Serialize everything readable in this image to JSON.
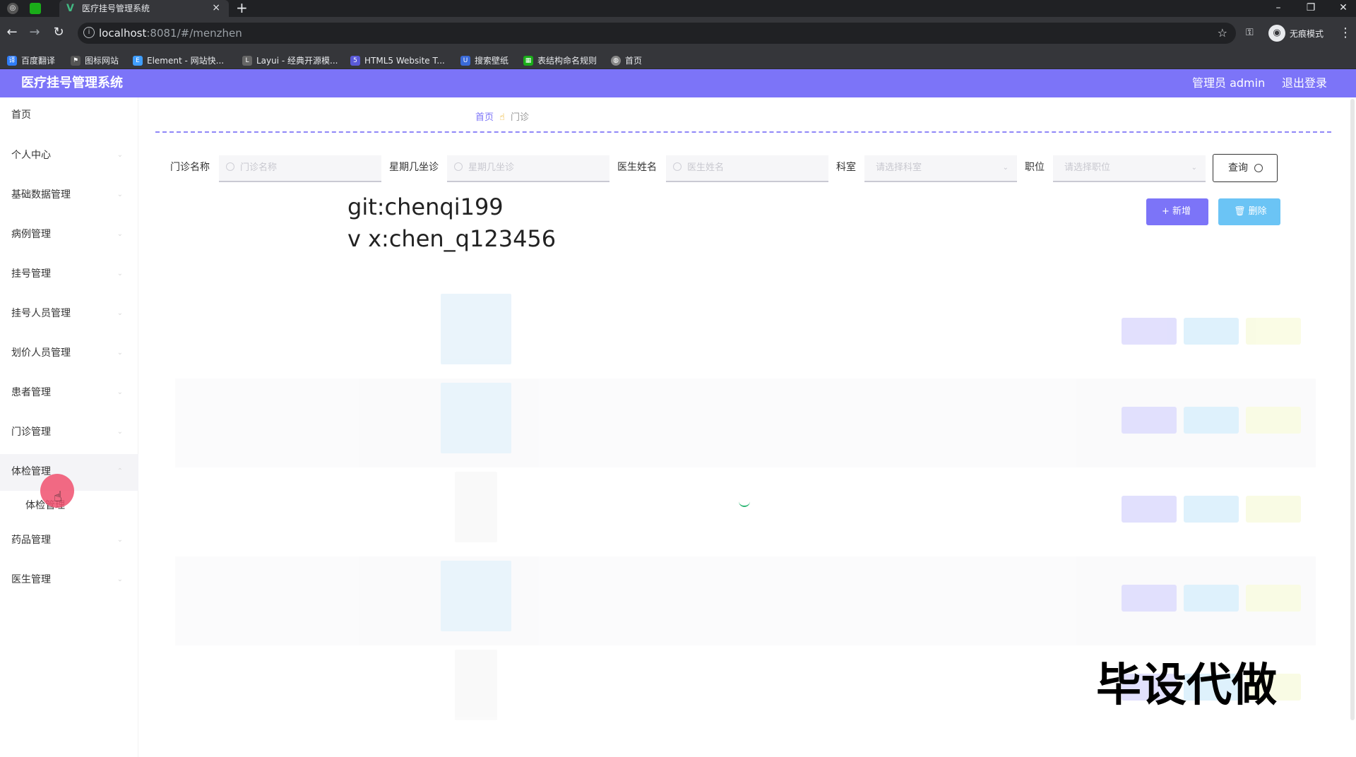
{
  "browser": {
    "tab_title": "医疗挂号管理系统",
    "tab_close": "×",
    "new_tab": "+",
    "url_host": "localhost",
    "url_rest": ":8081/#/menzhen",
    "incognito_label": "无痕模式",
    "window_controls": [
      "–",
      "❐",
      "✕"
    ],
    "bookmarks": [
      {
        "label": "百度翻译",
        "icon": "baidu-translate-icon",
        "color": "#2f7cf6"
      },
      {
        "label": "图标网站",
        "icon": "flag-icon",
        "color": "#555555"
      },
      {
        "label": "Element - 网站快...",
        "icon": "element-icon",
        "color": "#409eff"
      },
      {
        "label": "Layui - 经典开源模...",
        "icon": "layui-icon",
        "color": "#666666"
      },
      {
        "label": "HTML5 Website T...",
        "icon": "html5-icon",
        "color": "#5a5ad8"
      },
      {
        "label": "搜索壁纸",
        "icon": "wallpaper-icon",
        "color": "#3a6ad8"
      },
      {
        "label": "表结构命名规则",
        "icon": "table-icon",
        "color": "#1aad19"
      },
      {
        "label": "首页",
        "icon": "globe-icon",
        "color": "#888888"
      }
    ]
  },
  "app": {
    "title": "医疗挂号管理系统",
    "admin": "管理员 admin",
    "logout": "退出登录",
    "accent": "#7c74f8"
  },
  "sidebar": {
    "items": [
      {
        "label": "首页"
      },
      {
        "label": "个人中心"
      },
      {
        "label": "基础数据管理"
      },
      {
        "label": "病例管理"
      },
      {
        "label": "挂号管理"
      },
      {
        "label": "挂号人员管理"
      },
      {
        "label": "划价人员管理"
      },
      {
        "label": "患者管理"
      },
      {
        "label": "门诊管理"
      },
      {
        "label": "体检管理"
      },
      {
        "label": "药品管理"
      },
      {
        "label": "医生管理"
      }
    ],
    "submenu": {
      "label": "体检管理"
    }
  },
  "breadcrumb": {
    "home": "首页",
    "current": "门诊"
  },
  "search": {
    "fields": [
      {
        "label": "门诊名称",
        "placeholder": "门诊名称"
      },
      {
        "label": "星期几坐诊",
        "placeholder": "星期几坐诊"
      },
      {
        "label": "医生姓名",
        "placeholder": "医生姓名"
      },
      {
        "label": "科室",
        "placeholder": "请选择科室"
      },
      {
        "label": "职位",
        "placeholder": "请选择职位"
      }
    ],
    "query": "查询"
  },
  "actions": {
    "add": "+ 新增",
    "delete": "🗑 删除"
  },
  "watermarks": {
    "line1": "git:chenqi199",
    "line2": "v x:chen_q123456",
    "line3": "毕设代做"
  }
}
